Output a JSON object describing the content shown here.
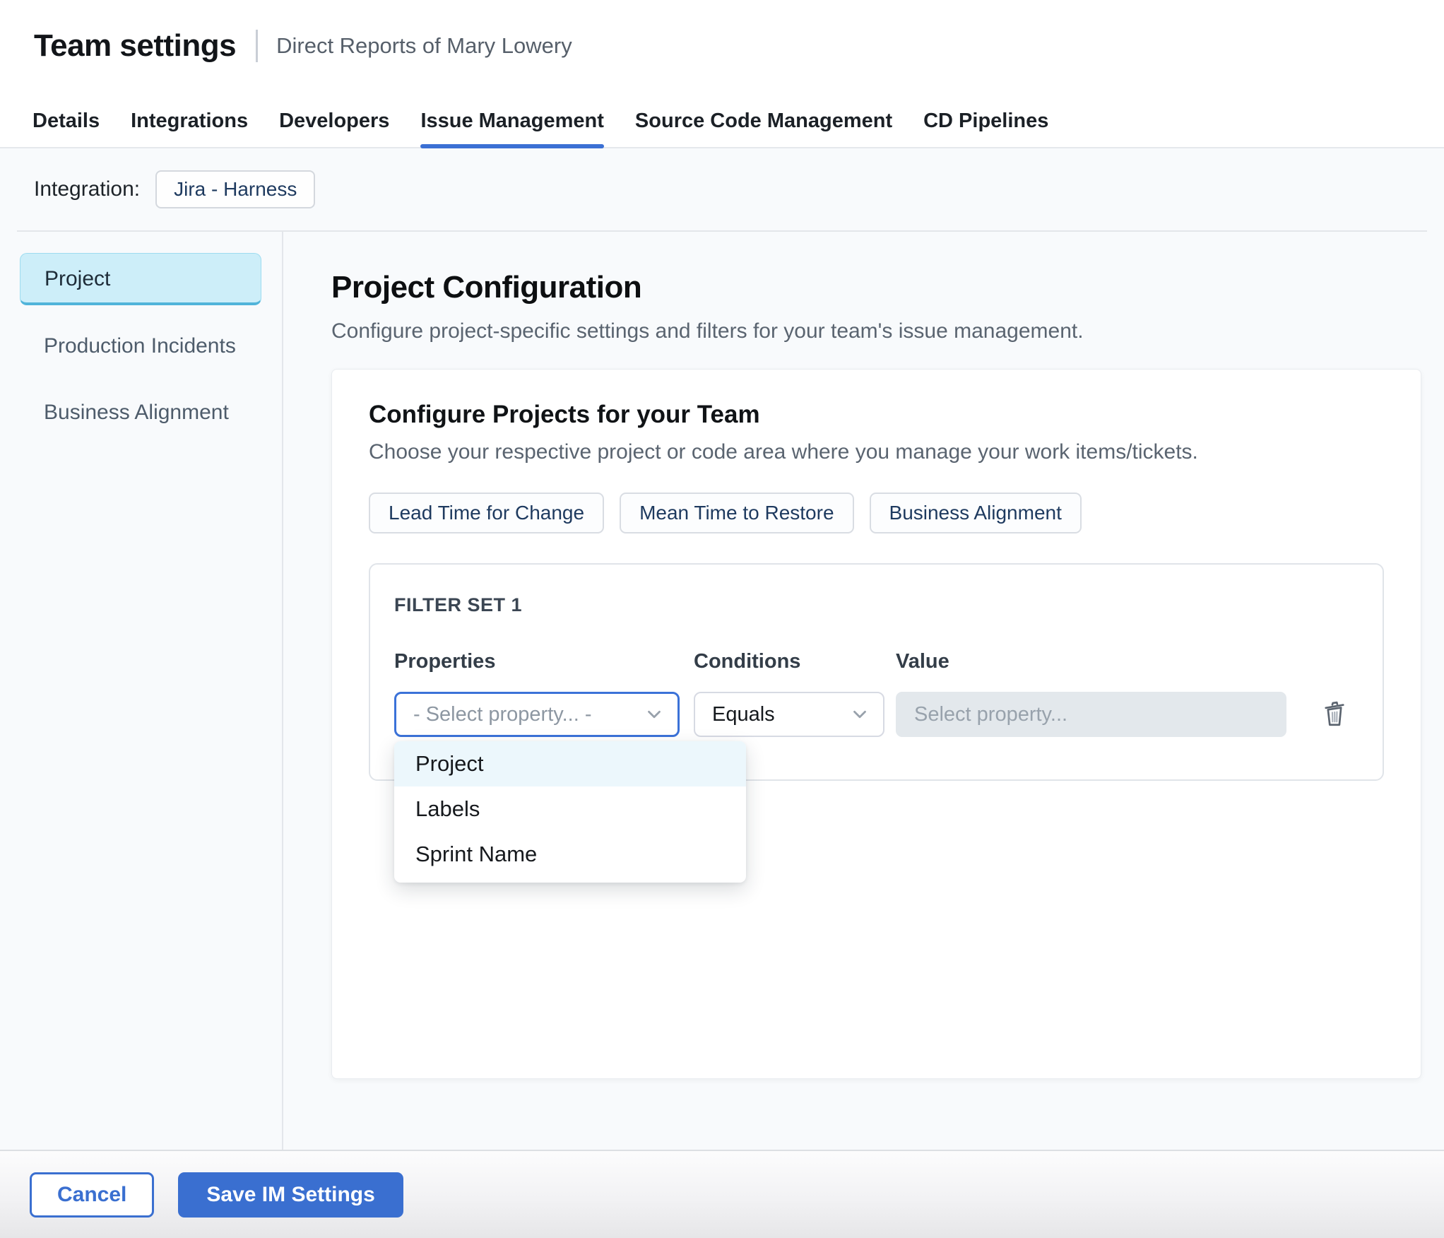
{
  "header": {
    "title": "Team settings",
    "subtitle": "Direct Reports of Mary Lowery"
  },
  "tabs": [
    {
      "label": "Details",
      "active": false
    },
    {
      "label": "Integrations",
      "active": false
    },
    {
      "label": "Developers",
      "active": false
    },
    {
      "label": "Issue Management",
      "active": true
    },
    {
      "label": "Source Code Management",
      "active": false
    },
    {
      "label": "CD Pipelines",
      "active": false
    }
  ],
  "integration": {
    "label": "Integration:",
    "chip": "Jira - Harness"
  },
  "sidebar": {
    "items": [
      {
        "label": "Project",
        "selected": true
      },
      {
        "label": "Production Incidents",
        "selected": false
      },
      {
        "label": "Business Alignment",
        "selected": false
      }
    ]
  },
  "main": {
    "heading": "Project Configuration",
    "description": "Configure project-specific settings and filters for your team's issue management.",
    "card": {
      "heading": "Configure Projects for your Team",
      "description": "Choose your respective project or code area where you manage your work items/tickets.",
      "chips": [
        "Lead Time for Change",
        "Mean Time to Restore",
        "Business Alignment"
      ],
      "filter_set": {
        "title": "FILTER SET 1",
        "columns": [
          "Properties",
          "Conditions",
          "Value"
        ],
        "properties_placeholder": "- Select property... -",
        "condition_value": "Equals",
        "value_placeholder": "Select property...",
        "dropdown_options": [
          "Project",
          "Labels",
          "Sprint Name"
        ],
        "dropdown_highlighted": "Project"
      }
    }
  },
  "footer": {
    "cancel_label": "Cancel",
    "save_label": "Save IM Settings"
  },
  "icons": {
    "properties_chevron": "chevron-down-icon",
    "conditions_chevron": "chevron-down-icon",
    "delete_filter": "trash-icon"
  },
  "colors": {
    "accent_blue": "#3b70d4",
    "sidebar_selected_bg": "#cdeef9",
    "sidebar_selected_edge": "#51b4da",
    "chip_text": "#1e3a5f",
    "dropdown_highlight": "#ecf7fc",
    "disabled_input_bg": "#e3e8ec"
  }
}
